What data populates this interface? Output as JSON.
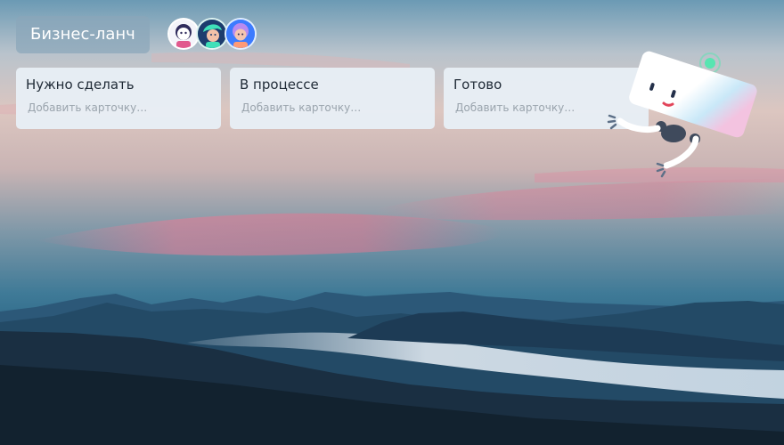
{
  "board": {
    "title": "Бизнес-ланч"
  },
  "members": [
    {
      "name": "avatar-1"
    },
    {
      "name": "avatar-2"
    },
    {
      "name": "avatar-3"
    }
  ],
  "lists": [
    {
      "title": "Нужно сделать",
      "add_card": "Добавить карточку…"
    },
    {
      "title": "В процессе",
      "add_card": "Добавить карточку…"
    },
    {
      "title": "Готово",
      "add_card": "Добавить карточку…"
    }
  ],
  "colors": {
    "title_bg": "#8aa6ba",
    "list_bg": "#e8eff6",
    "list_title": "#1f2a36",
    "add_card_text": "#9aa4ad",
    "sky_top": "#4a7f9a",
    "sky_pink": "#d98a9a",
    "mountains": "#1e3b52"
  },
  "icons": {
    "mascot": "robot-mascot-icon",
    "signal": "signal-ring-icon"
  }
}
